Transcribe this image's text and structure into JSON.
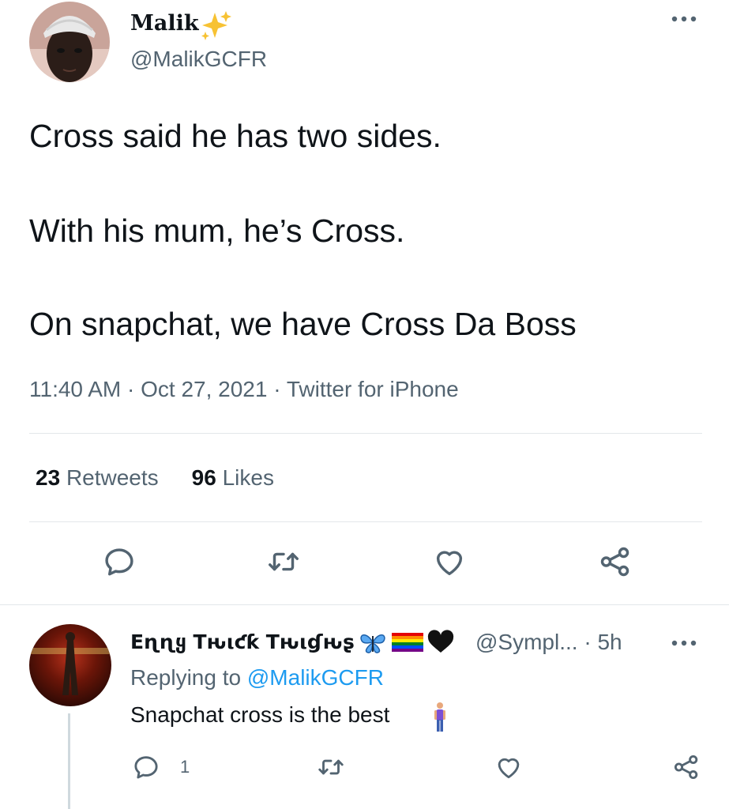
{
  "tweet": {
    "author": {
      "name": "Malik",
      "name_emoji_icon": "sparkles-icon",
      "handle": "@MalikGCFR"
    },
    "body_lines": [
      "Cross said he has two sides.",
      "With his mum, he’s Cross.",
      "On snapchat, we have Cross Da Boss"
    ],
    "timestamp": "11:40 AM · Oct 27, 2021 · Twitter for iPhone",
    "stats": {
      "retweets_count": "23",
      "retweets_label": "Retweets",
      "likes_count": "96",
      "likes_label": "Likes"
    },
    "actions": [
      "reply-icon",
      "retweet-icon",
      "like-icon",
      "share-icon"
    ]
  },
  "reply": {
    "author": {
      "name": "Eɳɳყ Tԋιƈƙ Tԋιɠԋʂ",
      "name_emojis": [
        "butterfly-icon",
        "rainbow-flag-icon",
        "black-heart-icon"
      ],
      "handle": "@Sympl...",
      "time": "· 5h"
    },
    "replying_prefix": "Replying to",
    "replying_mention": "@MalikGCFR",
    "text": "Snapchat cross is the best",
    "text_emoji_icon": "person-standing-icon",
    "reply_count": "1",
    "actions": [
      "reply-icon",
      "retweet-icon",
      "like-icon",
      "share-icon"
    ]
  },
  "colors": {
    "primary_text": "#0f1419",
    "secondary_text": "#536471",
    "link": "#1d9bf0",
    "divider": "#e3e7ea"
  }
}
